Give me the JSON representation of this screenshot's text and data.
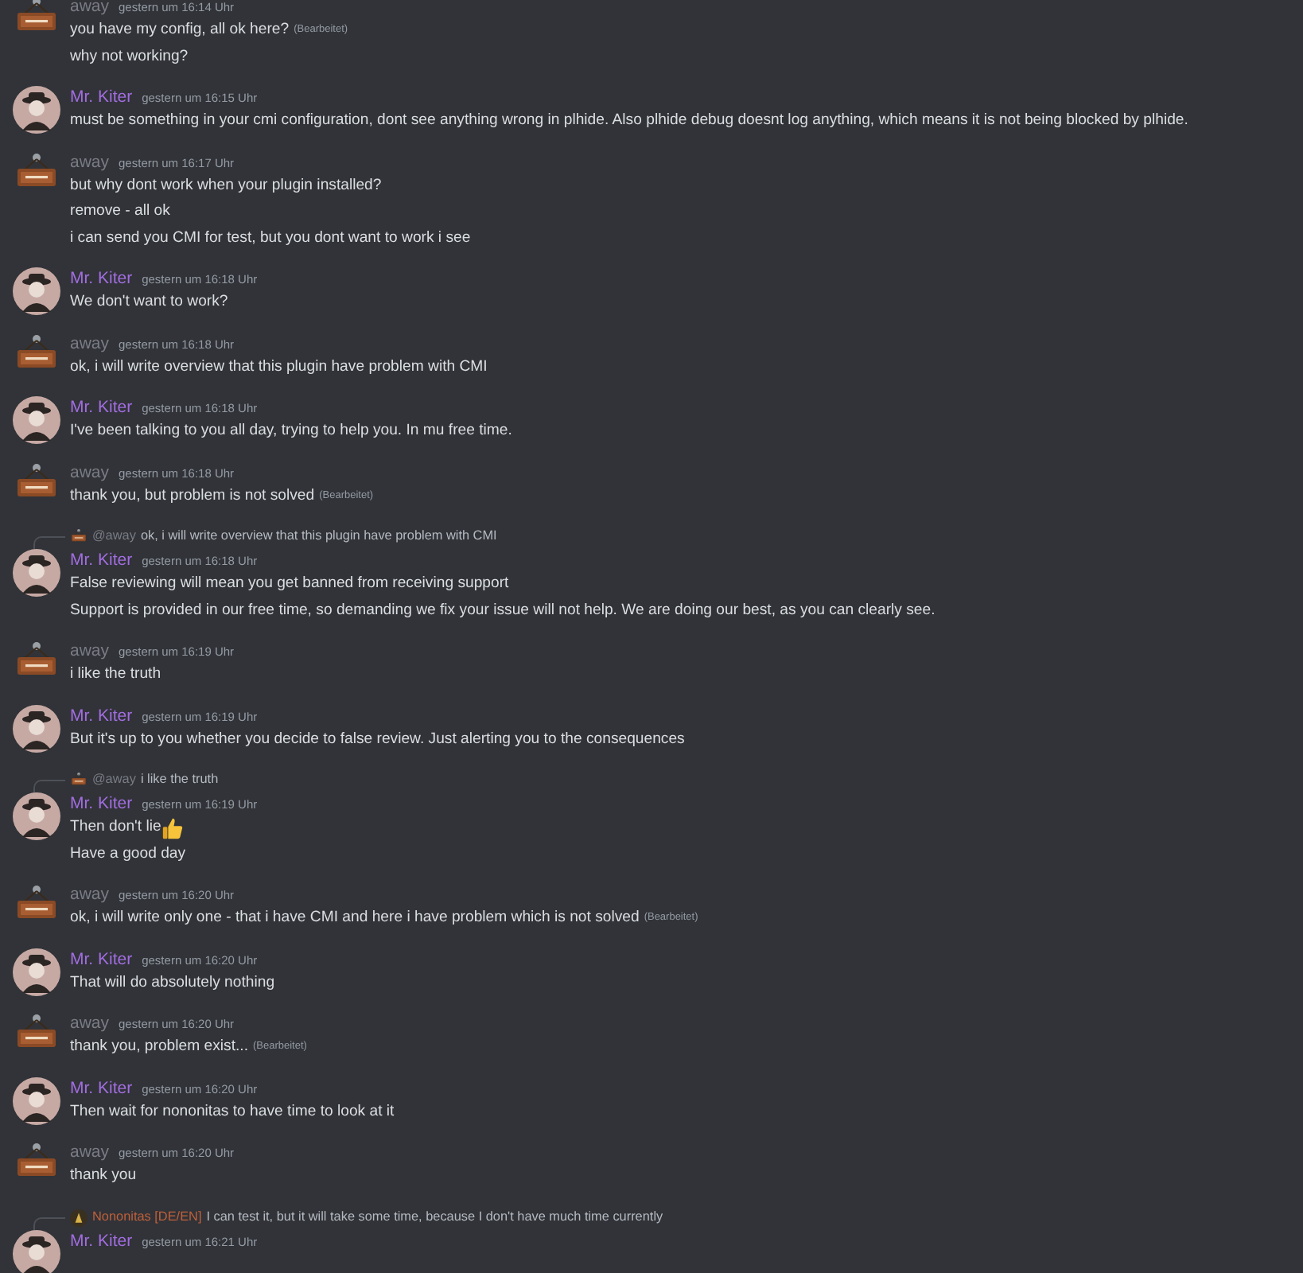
{
  "messages": [
    {
      "author": "away",
      "color": "#7a7c85",
      "kind": "sign",
      "time": "gestern um 16:14 Uhr",
      "lines": [
        {
          "text": "you have my config, all ok here?",
          "edited": "(Bearbeitet)"
        },
        {
          "text": "why not working?"
        }
      ]
    },
    {
      "author": "Mr. Kiter",
      "color": "#a26de0",
      "kind": "figure",
      "time": "gestern um 16:15 Uhr",
      "lines": [
        {
          "text": "must be something in your cmi configuration, dont see anything wrong in plhide. Also plhide debug doesnt log anything, which means it is not being blocked by plhide."
        }
      ]
    },
    {
      "author": "away",
      "color": "#7a7c85",
      "kind": "sign",
      "time": "gestern um 16:17 Uhr",
      "lines": [
        {
          "text": "but why dont work when your plugin installed?"
        },
        {
          "text": "remove - all ok"
        },
        {
          "text": "i can send you CMI for test, but you dont want to work i see"
        }
      ]
    },
    {
      "author": "Mr. Kiter",
      "color": "#a26de0",
      "kind": "figure",
      "time": "gestern um 16:18 Uhr",
      "lines": [
        {
          "text": "We don't want to work?"
        }
      ]
    },
    {
      "author": "away",
      "color": "#7a7c85",
      "kind": "sign",
      "time": "gestern um 16:18 Uhr",
      "lines": [
        {
          "text": "ok, i will write overview that this plugin have problem with CMI"
        }
      ]
    },
    {
      "author": "Mr. Kiter",
      "color": "#a26de0",
      "kind": "figure",
      "time": "gestern um 16:18 Uhr",
      "lines": [
        {
          "text": "I've been talking to you all day, trying to help you. In mu free time."
        }
      ]
    },
    {
      "author": "away",
      "color": "#7a7c85",
      "kind": "sign",
      "time": "gestern um 16:18 Uhr",
      "lines": [
        {
          "text": "thank you, but problem is not solved",
          "edited": "(Bearbeitet)"
        }
      ]
    },
    {
      "reply": {
        "kind": "sign",
        "name": "@away",
        "color": "#7a7c85",
        "text": "ok, i will write overview that this plugin have problem with CMI"
      },
      "author": "Mr. Kiter",
      "color": "#a26de0",
      "kind": "figure",
      "time": "gestern um 16:18 Uhr",
      "lines": [
        {
          "text": "False reviewing will mean you get banned from receiving support"
        },
        {
          "text": "Support is provided in our free time, so demanding we fix your issue will not help. We are doing our best, as you can clearly see."
        }
      ]
    },
    {
      "author": "away",
      "color": "#7a7c85",
      "kind": "sign",
      "time": "gestern um 16:19 Uhr",
      "lines": [
        {
          "text": "i like the truth"
        }
      ]
    },
    {
      "author": "Mr. Kiter",
      "color": "#a26de0",
      "kind": "figure",
      "time": "gestern um 16:19 Uhr",
      "lines": [
        {
          "text": "But it's up to you whether you decide to false review. Just alerting you to the consequences"
        }
      ]
    },
    {
      "reply": {
        "kind": "sign",
        "name": "@away",
        "color": "#7a7c85",
        "text": "i like the truth"
      },
      "author": "Mr. Kiter",
      "color": "#a26de0",
      "kind": "figure",
      "time": "gestern um 16:19 Uhr",
      "lines": [
        {
          "text": "Then don't lie",
          "thumbs_up": true
        },
        {
          "text": "Have a good day"
        }
      ]
    },
    {
      "author": "away",
      "color": "#7a7c85",
      "kind": "sign",
      "time": "gestern um 16:20 Uhr",
      "lines": [
        {
          "text": "ok, i will write only one - that i have CMI and here i have problem which is not solved",
          "edited": "(Bearbeitet)"
        }
      ]
    },
    {
      "author": "Mr. Kiter",
      "color": "#a26de0",
      "kind": "figure",
      "time": "gestern um 16:20 Uhr",
      "lines": [
        {
          "text": "That will do absolutely nothing"
        }
      ]
    },
    {
      "author": "away",
      "color": "#7a7c85",
      "kind": "sign",
      "time": "gestern um 16:20 Uhr",
      "lines": [
        {
          "text": "thank you, problem exist...",
          "edited": "(Bearbeitet)"
        }
      ]
    },
    {
      "author": "Mr. Kiter",
      "color": "#a26de0",
      "kind": "figure",
      "time": "gestern um 16:20 Uhr",
      "lines": [
        {
          "text": "Then wait for nononitas to have time to look at it"
        }
      ]
    },
    {
      "author": "away",
      "color": "#7a7c85",
      "kind": "sign",
      "time": "gestern um 16:20 Uhr",
      "lines": [
        {
          "text": "thank you"
        }
      ]
    },
    {
      "reply": {
        "kind": "mask",
        "name": "Nononitas [DE/EN]",
        "color": "#c0603a",
        "text": "I can test it, but it will take some time, because I don't have much time currently"
      },
      "author": "Mr. Kiter",
      "color": "#a26de0",
      "kind": "figure",
      "time": "gestern um 16:21 Uhr"
    }
  ]
}
